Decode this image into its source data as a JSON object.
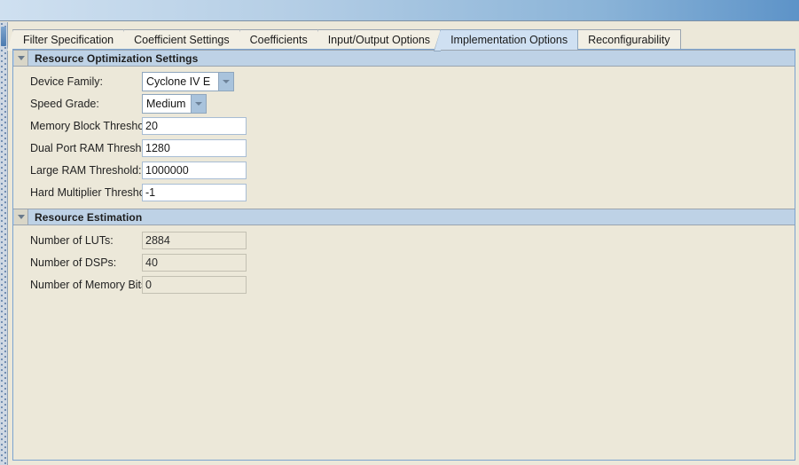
{
  "window": {
    "titlebar_label": ""
  },
  "colors": {
    "panel_bg": "#ece8d9",
    "section_header_bg": "#bed2e6",
    "selected_tab_bg": "#cfe0f2",
    "panel_border": "#7ba3d0",
    "titlebar_gradient_start": "#cfe0f0",
    "titlebar_gradient_end": "#5d93c8"
  },
  "tabs": [
    {
      "label": "Filter Specification",
      "selected": false,
      "name": "tab-filter-specification"
    },
    {
      "label": "Coefficient Settings",
      "selected": false,
      "name": "tab-coefficient-settings"
    },
    {
      "label": "Coefficients",
      "selected": false,
      "name": "tab-coefficients"
    },
    {
      "label": "Input/Output Options",
      "selected": false,
      "name": "tab-input-output-options"
    },
    {
      "label": "Implementation Options",
      "selected": true,
      "name": "tab-implementation-options"
    },
    {
      "label": "Reconfigurability",
      "selected": false,
      "name": "tab-reconfigurability"
    }
  ],
  "sections": [
    {
      "title": "Resource Optimization Settings",
      "expanded": true,
      "toggle_icon": "triangle-down-icon",
      "fields": [
        {
          "label": "Device Family:",
          "type": "combo",
          "value": "Cyclone IV E",
          "arrow_icon": "chevron-down-icon",
          "name": "device-family-combo"
        },
        {
          "label": "Speed Grade:",
          "type": "combo",
          "value": "Medium",
          "arrow_icon": "chevron-down-icon",
          "name": "speed-grade-combo"
        },
        {
          "label": "Memory Block Threshold:",
          "type": "text",
          "value": "20",
          "placeholder": "",
          "name": "memory-block-threshold-input"
        },
        {
          "label": "Dual Port RAM Threshold:",
          "type": "text",
          "value": "1280",
          "placeholder": "",
          "name": "dual-port-ram-threshold-input"
        },
        {
          "label": "Large RAM Threshold:",
          "type": "text",
          "value": "1000000",
          "placeholder": "",
          "name": "large-ram-threshold-input"
        },
        {
          "label": "Hard Multiplier Threshold:",
          "type": "text",
          "value": "-1",
          "placeholder": "",
          "name": "hard-multiplier-threshold-input"
        }
      ]
    },
    {
      "title": "Resource Estimation",
      "expanded": true,
      "toggle_icon": "triangle-down-icon",
      "fields": [
        {
          "label": "Number of LUTs:",
          "type": "text-readonly",
          "value": "2884",
          "placeholder": "",
          "name": "number-of-luts-output"
        },
        {
          "label": "Number of DSPs:",
          "type": "text-readonly",
          "value": "40",
          "placeholder": "",
          "name": "number-of-dsps-output"
        },
        {
          "label": "Number of Memory Bits:",
          "type": "text-readonly",
          "value": "0",
          "placeholder": "",
          "name": "number-of-memory-bits-output"
        }
      ]
    }
  ]
}
